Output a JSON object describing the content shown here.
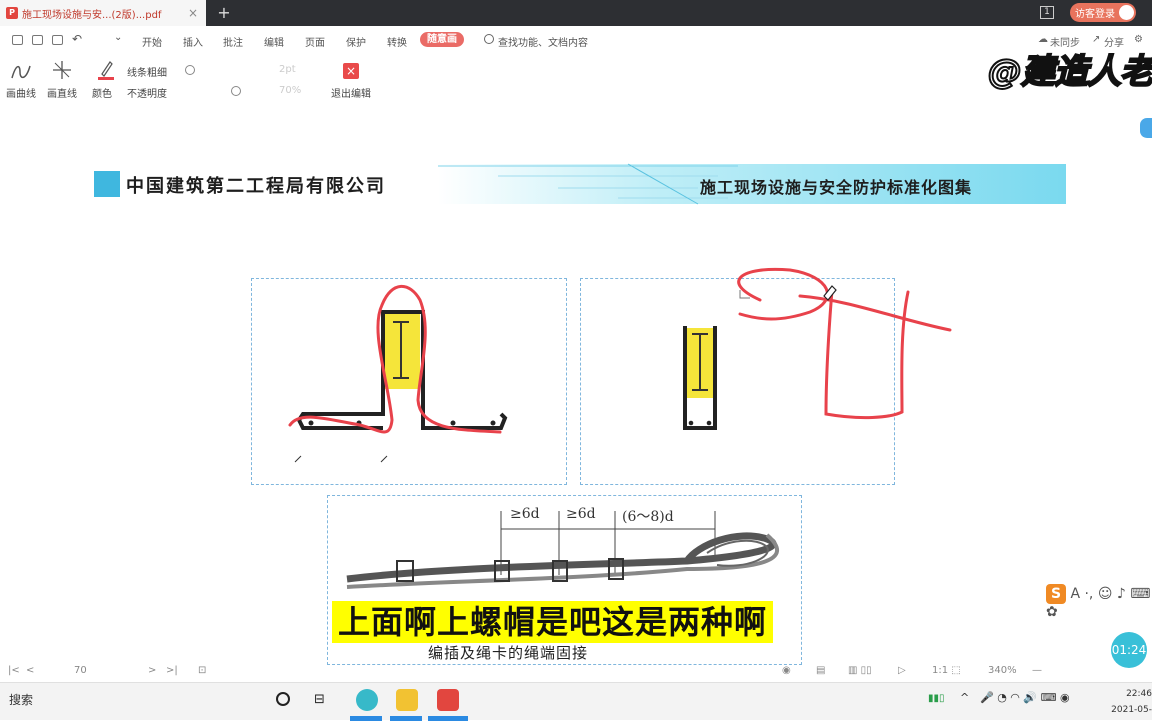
{
  "tab": {
    "title": "施工现场设施与安...(2版)...pdf",
    "add": "+"
  },
  "titlebar": {
    "page_count": "1",
    "login": "访客登录"
  },
  "menu": {
    "items": [
      "开始",
      "插入",
      "批注",
      "编辑",
      "页面",
      "保护",
      "转换"
    ],
    "active": "随意画",
    "search": "查找功能、文档内容",
    "sync": "未同步",
    "share": "分享"
  },
  "draw_toolbar": {
    "curve": "画曲线",
    "line": "画直线",
    "color": "颜色",
    "thickness": "线条粗细",
    "opacity": "不透明度",
    "pt": "2pt",
    "percent": "70%",
    "exit": "退出编辑"
  },
  "watermark": "@建造人老",
  "document": {
    "company": "中国建筑第二工程局有限公司",
    "series": "施工现场设施与安全防护标准化图集",
    "dims": [
      "≥6d",
      "≥6d",
      "(6～8)d"
    ],
    "caption": "编插及绳卡的绳端固接"
  },
  "subtitle": "上面啊上螺帽是吧这是两种啊",
  "status": {
    "page": "70",
    "zoom": "340%"
  },
  "taskbar": {
    "search": "搜索",
    "time": "22:46",
    "date": "2021-05-"
  },
  "timer": "01:24",
  "colors": {
    "accent": "#ea6b66",
    "annotation": "#e8424b",
    "highlight": "#ffff00",
    "brand_blue": "#3fb7df"
  }
}
